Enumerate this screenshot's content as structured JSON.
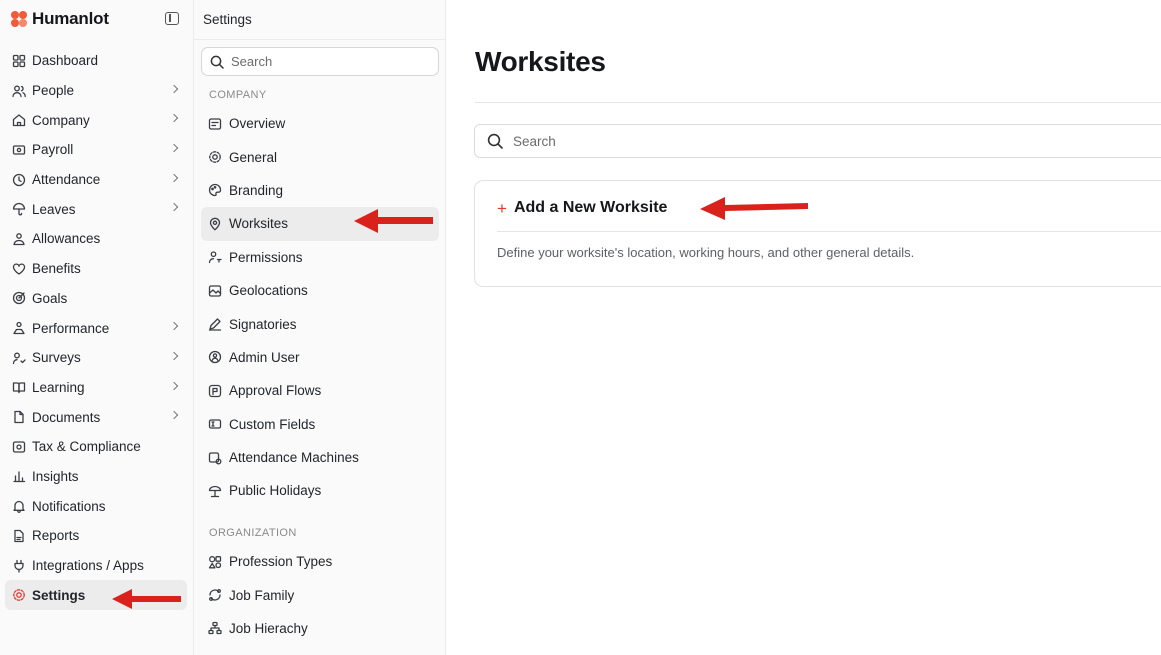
{
  "brand": {
    "name": "Humanlot",
    "logo_color": "#f15a3a"
  },
  "nav": {
    "items": [
      {
        "label": "Dashboard",
        "icon": "dashboard-icon",
        "chevron": false
      },
      {
        "label": "People",
        "icon": "people-icon",
        "chevron": true
      },
      {
        "label": "Company",
        "icon": "company-icon",
        "chevron": true
      },
      {
        "label": "Payroll",
        "icon": "payroll-icon",
        "chevron": true
      },
      {
        "label": "Attendance",
        "icon": "clock-icon",
        "chevron": true
      },
      {
        "label": "Leaves",
        "icon": "umbrella-icon",
        "chevron": true
      },
      {
        "label": "Allowances",
        "icon": "allowance-icon",
        "chevron": false
      },
      {
        "label": "Benefits",
        "icon": "heart-icon",
        "chevron": false
      },
      {
        "label": "Goals",
        "icon": "target-icon",
        "chevron": false
      },
      {
        "label": "Performance",
        "icon": "performance-icon",
        "chevron": true
      },
      {
        "label": "Surveys",
        "icon": "survey-icon",
        "chevron": true
      },
      {
        "label": "Learning",
        "icon": "book-icon",
        "chevron": true
      },
      {
        "label": "Documents",
        "icon": "document-icon",
        "chevron": true
      },
      {
        "label": "Tax & Compliance",
        "icon": "tax-icon",
        "chevron": false
      },
      {
        "label": "Insights",
        "icon": "chart-icon",
        "chevron": false
      },
      {
        "label": "Notifications",
        "icon": "bell-icon",
        "chevron": false
      },
      {
        "label": "Reports",
        "icon": "report-icon",
        "chevron": false
      },
      {
        "label": "Integrations / Apps",
        "icon": "plug-icon",
        "chevron": false
      },
      {
        "label": "Settings",
        "icon": "gear-icon",
        "chevron": false,
        "active": true
      }
    ]
  },
  "settings": {
    "title": "Settings",
    "search_placeholder": "Search",
    "company_label": "COMPANY",
    "company_items": [
      {
        "label": "Overview",
        "icon": "overview-icon"
      },
      {
        "label": "General",
        "icon": "gear-icon"
      },
      {
        "label": "Branding",
        "icon": "palette-icon"
      },
      {
        "label": "Worksites",
        "icon": "location-pin-icon",
        "active": true
      },
      {
        "label": "Permissions",
        "icon": "user-key-icon"
      },
      {
        "label": "Geolocations",
        "icon": "map-icon"
      },
      {
        "label": "Signatories",
        "icon": "pen-icon"
      },
      {
        "label": "Admin User",
        "icon": "admin-icon"
      },
      {
        "label": "Approval Flows",
        "icon": "flow-icon"
      },
      {
        "label": "Custom Fields",
        "icon": "fields-icon"
      },
      {
        "label": "Attendance Machines",
        "icon": "machine-icon"
      },
      {
        "label": "Public Holidays",
        "icon": "holiday-icon"
      }
    ],
    "organization_label": "ORGANIZATION",
    "organization_items": [
      {
        "label": "Profession Types",
        "icon": "shapes-icon"
      },
      {
        "label": "Job Family",
        "icon": "family-icon"
      },
      {
        "label": "Job Hierachy",
        "icon": "hierarchy-icon"
      }
    ]
  },
  "main": {
    "title": "Worksites",
    "search_placeholder": "Search",
    "add_label": "Add a New Worksite",
    "add_description": "Define your worksite's location, working hours, and other general details."
  },
  "colors": {
    "accent": "#e23b2e",
    "arrow": "#d9221c",
    "active_bg": "#ececec"
  }
}
